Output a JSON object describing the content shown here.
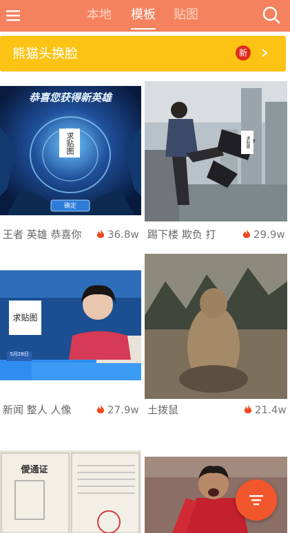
{
  "header": {
    "tabs": [
      {
        "label": "本地",
        "active": false
      },
      {
        "label": "模板",
        "active": true
      },
      {
        "label": "贴图",
        "active": false
      }
    ],
    "menu_icon": "hamburger-menu-icon",
    "search_icon": "search-icon"
  },
  "banner": {
    "title": "熊猫头换脸",
    "badge": "新",
    "arrow_icon": "chevron-right-icon"
  },
  "templates": [
    {
      "caption": "王者 英雄 恭喜你",
      "count": "36.8w",
      "img_title": "恭喜您获得新英雄",
      "img_button": "确定",
      "overlay": "求贴图"
    },
    {
      "caption": "踢下楼 欺负 打",
      "count": "29.9w",
      "overlay": "求贴图"
    },
    {
      "caption": "新闻 整人 人像",
      "count": "27.9w",
      "overlay": "求贴图",
      "img_date": "5月28日"
    },
    {
      "caption": "土拨鼠",
      "count": "21.4w"
    },
    {
      "caption": "",
      "count": "",
      "img_title": "僾通证"
    },
    {
      "caption": "",
      "count": ""
    }
  ],
  "fab": {
    "icon": "filter-icon"
  },
  "colors": {
    "header": "#f5825e",
    "banner": "#fcc314",
    "badge": "#e02c1a",
    "fab": "#f2562c",
    "flame": "#f04a1e"
  }
}
